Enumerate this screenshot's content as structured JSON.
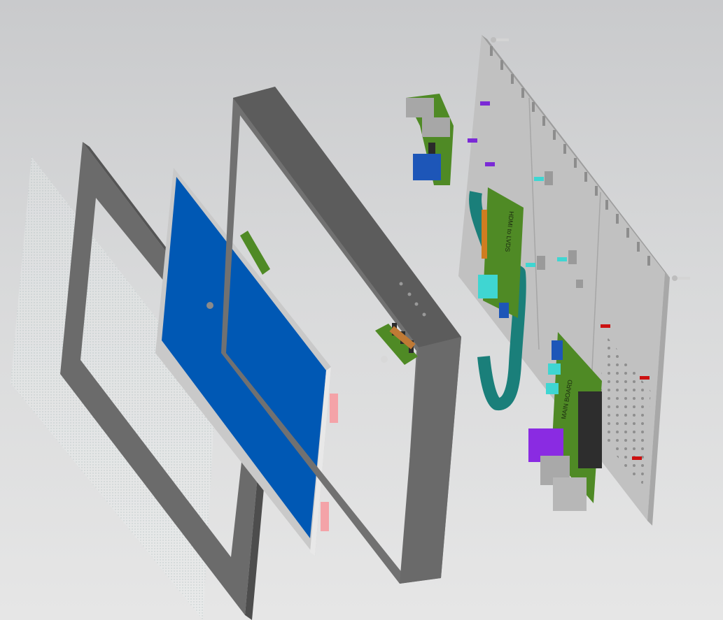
{
  "scene": {
    "background_top": "#c9cacc",
    "background_bottom": "#e6e6e6"
  },
  "parts": [
    {
      "id": "glass-cover",
      "color": "#eef2f2"
    },
    {
      "id": "front-bezel",
      "color": "#6b6b6b"
    },
    {
      "id": "lcd-panel",
      "color": "#0058b4"
    },
    {
      "id": "housing-frame",
      "color": "#646464"
    },
    {
      "id": "back-plate",
      "color": "#bdbdbd"
    },
    {
      "id": "pcb-board",
      "color": "#4f8a25"
    },
    {
      "id": "ribbon-cable",
      "color": "#1a7f7a"
    },
    {
      "id": "connector-cyan",
      "color": "#3fd6d2"
    },
    {
      "id": "connector-purple",
      "color": "#8a2be2"
    },
    {
      "id": "standoff-red",
      "color": "#cc1111"
    },
    {
      "id": "pink-clip",
      "color": "#f4a3a8"
    }
  ],
  "pcb_labels": {
    "upper": "HDMI to LVDS",
    "lower": "MAIN BOARD"
  }
}
